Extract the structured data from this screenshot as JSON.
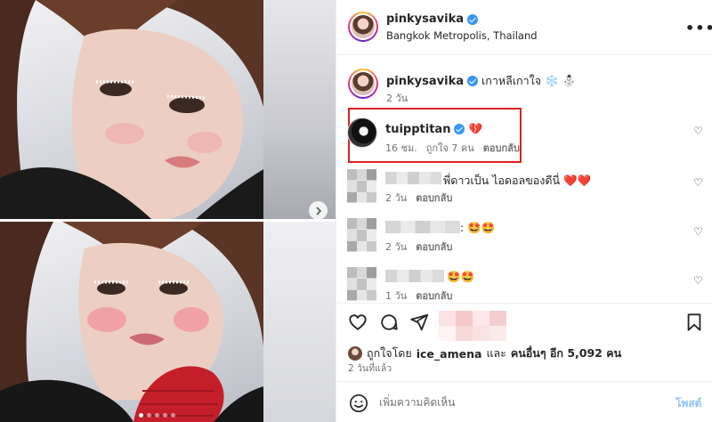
{
  "post": {
    "username": "pinkysavika",
    "location": "Bangkok Metropolis, Thailand",
    "more_icon": "more-options-icon"
  },
  "caption": {
    "username": "pinkysavika",
    "text": "เกาหลีเกาใจ ❄️ ⛄",
    "time": "2 วัน"
  },
  "highlighted_comment": {
    "username": "tuipptitan",
    "text": "💔",
    "time": "16 ชม.",
    "likes": "ถูกใจ 7 คน",
    "reply": "ตอบกลับ"
  },
  "comments": [
    {
      "text": "พี่ดาวเป็น ไอดอลของดีนี่ ❤️❤️",
      "time": "2 วัน",
      "reply": "ตอบกลับ"
    },
    {
      "text": ": 🤩🤩",
      "time": "2 วัน",
      "reply": "ตอบกลับ"
    },
    {
      "text": "🤩🤩",
      "time": "1 วัน",
      "reply": "ตอบกลับ"
    }
  ],
  "engagement": {
    "liked_by_prefix": "ถูกใจโดย",
    "liked_by_user": "ice_amena",
    "liked_by_mid": "และ",
    "liked_by_others": "คนอื่นๆ อีก 5,092 คน",
    "posted_ago": "2 วันที่แล้ว"
  },
  "comment_box": {
    "placeholder": "เพิ่มความคิดเห็น",
    "post_label": "โพสต์"
  },
  "carousel": {
    "slides": 5,
    "active_slide": 1
  }
}
